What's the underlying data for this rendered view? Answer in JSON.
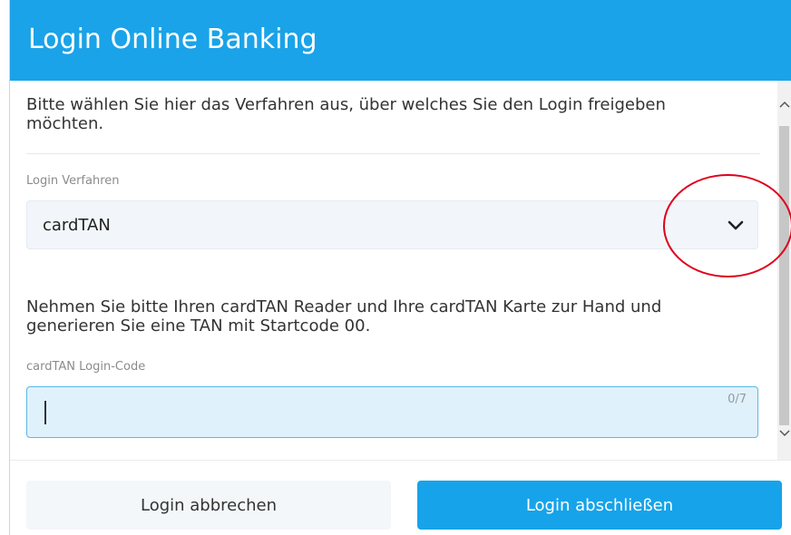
{
  "dialog": {
    "title": "Login Online Banking"
  },
  "content": {
    "intro_text": "Bitte wählen Sie hier das Verfahren aus, über welches Sie den Login freigeben möchten.",
    "method_label": "Login Verfahren",
    "method_selected": "cardTAN",
    "method_icon": "chevron-down-icon",
    "info_text": "Nehmen Sie bitte Ihren cardTAN Reader und Ihre cardTAN Karte zur Hand und generieren Sie eine TAN mit Startcode 00.",
    "code_label": "cardTAN Login-Code",
    "code_value": "",
    "code_counter": "0/7"
  },
  "footer": {
    "cancel_label": "Login abbrechen",
    "submit_label": "Login abschließen"
  },
  "colors": {
    "header": "#1aa3e8",
    "primary_button": "#17a3e9",
    "input_focus_bg": "#dff2fc",
    "annotation": "#e0001b"
  }
}
